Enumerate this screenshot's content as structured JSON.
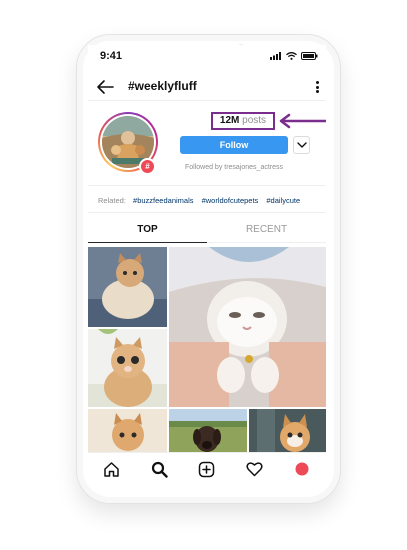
{
  "status": {
    "time": "9:41"
  },
  "header": {
    "title": "#weeklyfluff",
    "back_icon": "arrow-left-icon",
    "more_icon": "more-vertical-icon"
  },
  "profile": {
    "posts_count": "12M",
    "posts_label": "posts",
    "follow_label": "Follow",
    "followed_by": "Followed by tresajones_actress",
    "badge": "#"
  },
  "related": {
    "label": "Related:",
    "tags": [
      "#buzzfeedanimals",
      "#worldofcutepets",
      "#dailycute"
    ]
  },
  "tabs": [
    "TOP",
    "RECENT"
  ],
  "nav": [
    "home-icon",
    "search-icon",
    "add-post-icon",
    "heart-icon",
    "profile-icon"
  ],
  "colors": {
    "follow": "#3897f0",
    "annotation": "#7b2d8e",
    "badge": "#ed4956",
    "tag_link": "#003569"
  }
}
